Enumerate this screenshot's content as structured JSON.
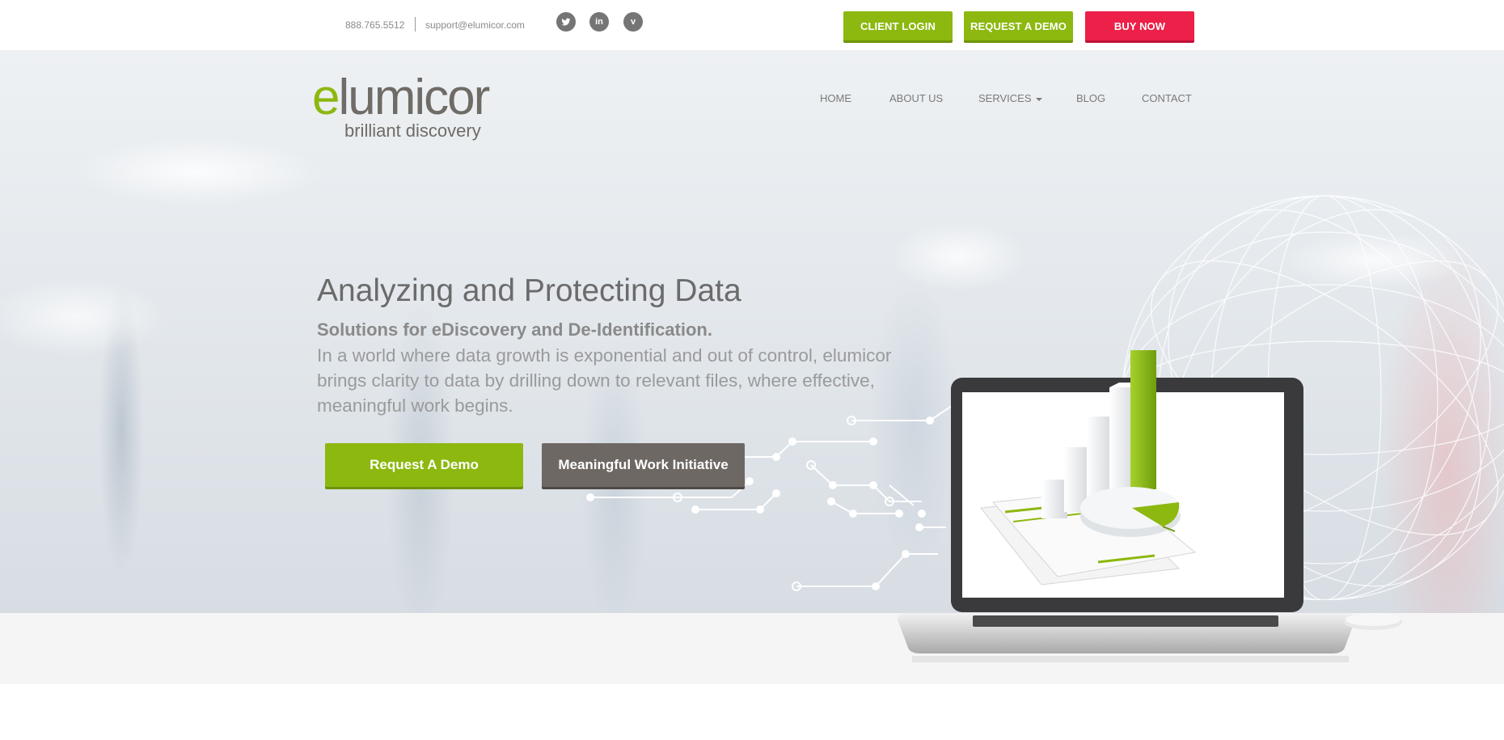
{
  "topbar": {
    "phone": "888.765.5512",
    "email": "support@elumicor.com",
    "social": [
      {
        "name": "twitter-icon",
        "glyph": "bird"
      },
      {
        "name": "linkedin-icon",
        "glyph": "in"
      },
      {
        "name": "vimeo-icon",
        "glyph": "v"
      }
    ],
    "buttons": {
      "client_login": "CLIENT LOGIN",
      "request_demo": "REQUEST A DEMO",
      "buy_now": "BUY NOW"
    }
  },
  "brand": {
    "logo_e": "e",
    "logo_rest": "lumicor",
    "tagline": "brilliant discovery"
  },
  "nav": {
    "home": "HOME",
    "about": "ABOUT US",
    "services": "SERVICES",
    "blog": "BLOG",
    "contact": "CONTACT"
  },
  "hero": {
    "title": "Analyzing and Protecting Data",
    "subtitle": "Solutions for eDiscovery and De-Identification.",
    "body": "In a world where data growth is exponential and out of control, elumicor brings clarity to data by drilling down to relevant files, where effective, meaningful work begins.",
    "cta_primary": "Request A Demo",
    "cta_secondary": "Meaningful Work Initiative"
  },
  "colors": {
    "accent_green": "#8cb80f",
    "accent_red": "#ec2049",
    "secondary_gray": "#6e6864",
    "text_gray": "#6b6b6b"
  }
}
